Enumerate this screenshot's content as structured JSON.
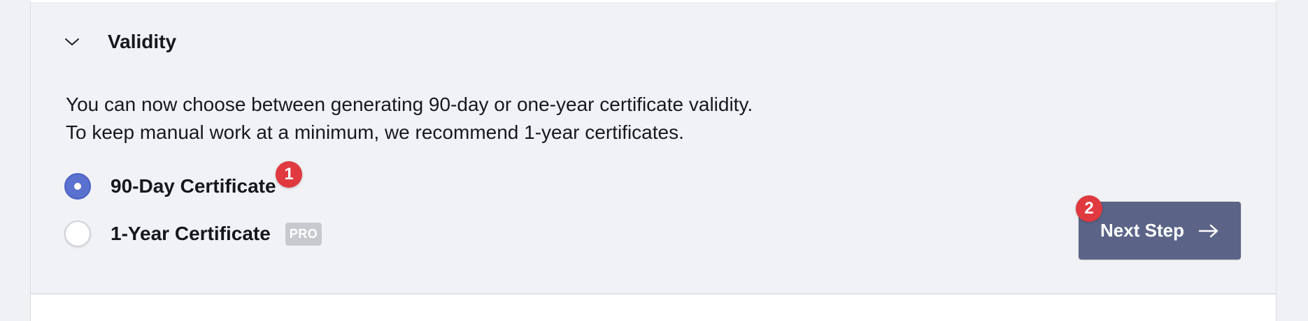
{
  "section": {
    "title": "Validity",
    "chevron_icon": "chevron-down-icon",
    "description": [
      "You can now choose between generating 90-day or one-year certificate validity.",
      "To keep manual work at a minimum, we recommend 1-year certificates."
    ]
  },
  "options": [
    {
      "label": "90-Day Certificate",
      "selected": true
    },
    {
      "label": "1-Year Certificate",
      "selected": false,
      "badge": "PRO"
    }
  ],
  "annotations": {
    "marker_1": "1",
    "marker_2": "2"
  },
  "next_button": {
    "label": "Next Step",
    "icon": "arrow-right-icon"
  },
  "colors": {
    "radio_selected": "#5a71cf",
    "button_bg": "#5b6487",
    "marker_red": "#e0393f",
    "pro_badge_bg": "#c7c9ce",
    "panel_bg": "#f1f2f5"
  }
}
